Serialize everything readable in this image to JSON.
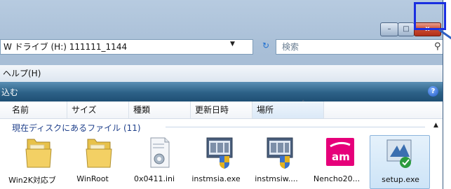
{
  "window": {
    "min_label": "–",
    "max_label": "□",
    "close_label": "x"
  },
  "address": {
    "path": "W ドライブ (H:) 111111_1144",
    "search_placeholder": "検索"
  },
  "menu": {
    "help": "ヘルプ(H)"
  },
  "toolbar": {
    "label": "込む",
    "help_glyph": "?"
  },
  "columns": [
    "名前",
    "サイズ",
    "種類",
    "更新日時",
    "場所"
  ],
  "group": {
    "label": "現在ディスクにあるファイル (11)"
  },
  "files": [
    {
      "label": "Win2K対応ブ",
      "icon": "folder-icon"
    },
    {
      "label": "WinRoot",
      "icon": "folder-icon"
    },
    {
      "label": "0x0411.ini",
      "icon": "settings-file-icon"
    },
    {
      "label": "instmsia.exe",
      "icon": "installer-icon"
    },
    {
      "label": "instmsiw....",
      "icon": "installer-icon"
    },
    {
      "label": "Nencho20...",
      "icon": "nencho-app-icon"
    },
    {
      "label": "setup.exe",
      "icon": "setup-icon"
    }
  ],
  "colors": {
    "toolbar": "#2c6187",
    "highlight_box": "#1a2fe0",
    "group_text": "#1e3f8a"
  }
}
